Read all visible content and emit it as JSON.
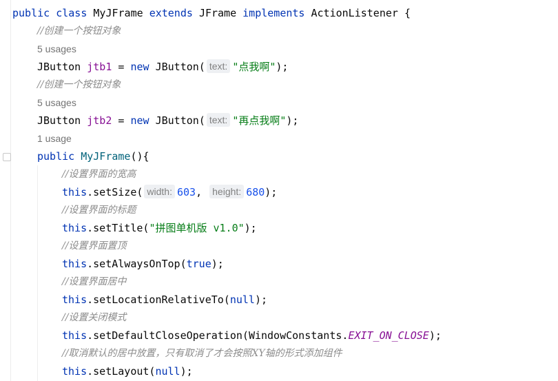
{
  "code": {
    "l1": {
      "k1": "public",
      "k2": "class",
      "name": "MyJFrame",
      "k3": "extends",
      "t1": "JFrame",
      "k4": "implements",
      "t2": "ActionListener",
      "tail": "{"
    },
    "l2": {
      "comment": "//创建一个按钮对象"
    },
    "l3": {
      "usage": "5 usages"
    },
    "l4": {
      "type": "JButton",
      "field": "jtb1",
      "eq": "=",
      "kw": "new",
      "ctor": "JButton(",
      "hint": "text:",
      "str": "\"点我啊\"",
      "tail": ");"
    },
    "l5": {
      "comment": "//创建一个按钮对象"
    },
    "l6": {
      "usage": "5 usages"
    },
    "l7": {
      "type": "JButton",
      "field": "jtb2",
      "eq": "=",
      "kw": "new",
      "ctor": "JButton(",
      "hint": "text:",
      "str": "\"再点我啊\"",
      "tail": ");"
    },
    "l8": {
      "usage": "1 usage"
    },
    "l9": {
      "kw": "public",
      "method": "MyJFrame",
      "tail": "(){"
    },
    "l10": {
      "comment": "//设置界面的宽高"
    },
    "l11": {
      "kw": "this",
      "call": ".setSize(",
      "hint1": "width:",
      "n1": "603",
      "sep": ",",
      "hint2": "height:",
      "n2": "680",
      "tail": ");"
    },
    "l12": {
      "comment": "//设置界面的标题"
    },
    "l13": {
      "kw": "this",
      "call": ".setTitle(",
      "str": "\"拼图单机版 v1.0\"",
      "tail": ");"
    },
    "l14": {
      "comment": "//设置界面置顶"
    },
    "l15": {
      "kw": "this",
      "call": ".setAlwaysOnTop(",
      "val": "true",
      "tail": ");"
    },
    "l16": {
      "comment": "//设置界面居中"
    },
    "l17": {
      "kw": "this",
      "call": ".setLocationRelativeTo(",
      "val": "null",
      "tail": ");"
    },
    "l18": {
      "comment": "//设置关闭模式"
    },
    "l19": {
      "kw": "this",
      "call": ".setDefaultCloseOperation(",
      "cls": "WindowConstants.",
      "const": "EXIT_ON_CLOSE",
      "tail": ");"
    },
    "l20": {
      "comment": "//取消默认的居中放置，只有取消了才会按照XY轴的形式添加组件"
    },
    "l21": {
      "kw": "this",
      "call": ".setLayout(",
      "val": "null",
      "tail": ");"
    }
  }
}
